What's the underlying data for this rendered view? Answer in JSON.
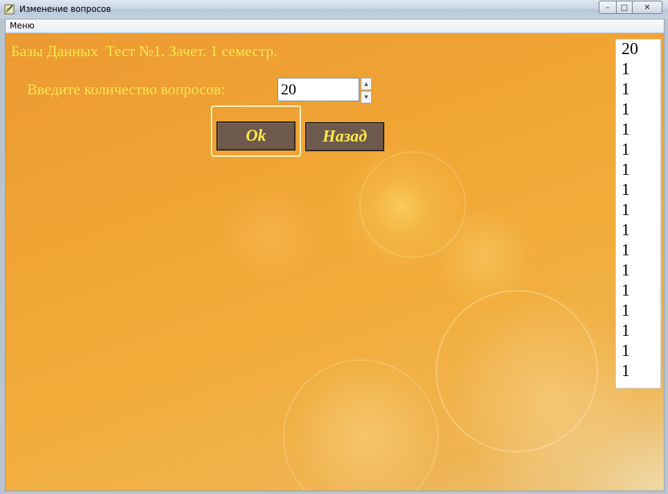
{
  "window": {
    "title": "Изменение вопросов",
    "controls": {
      "minimize": "–",
      "maximize": "□",
      "close": "✕"
    }
  },
  "menubar": {
    "items": [
      {
        "label": "Меню"
      }
    ]
  },
  "main": {
    "header_title": "Базы Данных  Тест №1. Зачет. 1 семестр.",
    "question_count_label": "Введите количество вопросов:",
    "question_count_value": "20",
    "spin_up": "▲",
    "spin_down": "▼",
    "ok_button": "Ok",
    "back_button": "Назад"
  },
  "side_list": {
    "items": [
      "20",
      "1",
      "1",
      "1",
      "1",
      "1",
      "1",
      "1",
      "1",
      "1",
      "1",
      "1",
      "1",
      "1",
      "1",
      "1",
      "1"
    ]
  },
  "colors": {
    "background": "#f0a534",
    "label_text": "#ffe84d",
    "button_fill": "#6d5a4d",
    "button_text": "#ffea4a"
  }
}
